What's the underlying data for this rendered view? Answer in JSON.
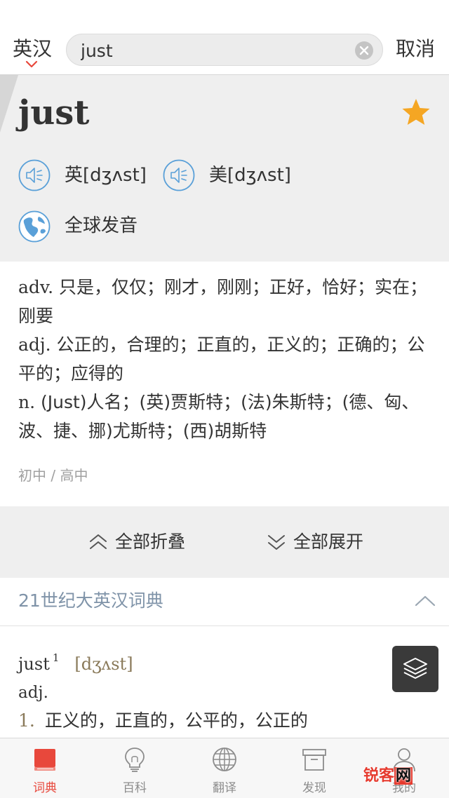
{
  "search": {
    "lang_label": "英汉",
    "query": "just",
    "cancel_label": "取消"
  },
  "word": {
    "headword": "just",
    "favorited": true,
    "pronunciations": [
      {
        "region": "英",
        "phonetic": "[dʒʌst]",
        "label": "英[dʒʌst]"
      },
      {
        "region": "美",
        "phonetic": "[dʒʌst]",
        "label": "美[dʒʌst]"
      }
    ],
    "global_label": "全球发音"
  },
  "definitions": [
    {
      "pos": "adv.",
      "text": " 只是，仅仅；刚才，刚刚；正好，恰好；实在；刚要"
    },
    {
      "pos": "adj.",
      "text": " 公正的，合理的；正直的，正义的；正确的；公平的；应得的"
    },
    {
      "pos": "n.",
      "text": " (Just)人名；(英)贾斯特；(法)朱斯特；(德、匈、波、捷、挪)尤斯特；(西)胡斯特"
    }
  ],
  "levels": "初中 / 高中",
  "fold": {
    "collapse_label": "全部折叠",
    "expand_label": "全部展开"
  },
  "dictionary": {
    "title": "21世纪大英汉词典",
    "entry_word": "just",
    "entry_superscript": "1",
    "entry_phonetic": "[dʒʌst]",
    "entry_pos": "adj.",
    "senses": [
      {
        "num": "1.",
        "text": "正义的，正直的，公平的，公正的"
      }
    ]
  },
  "tabs": [
    {
      "label": "词典",
      "icon": "book-icon",
      "active": true
    },
    {
      "label": "百科",
      "icon": "lightbulb-icon",
      "active": false
    },
    {
      "label": "翻译",
      "icon": "globe-grid-icon",
      "active": false
    },
    {
      "label": "发现",
      "icon": "archive-box-icon",
      "active": false
    },
    {
      "label": "我的",
      "icon": "person-icon",
      "active": false
    }
  ],
  "watermark": {
    "part1": "锐客",
    "part2": "网"
  },
  "colors": {
    "accent_red": "#e8483c",
    "star_orange": "#f5a623",
    "dict_title_blue": "#7f93a8",
    "speaker_blue": "#5aa0d8",
    "phonetic_brown": "#8a7a5a"
  }
}
